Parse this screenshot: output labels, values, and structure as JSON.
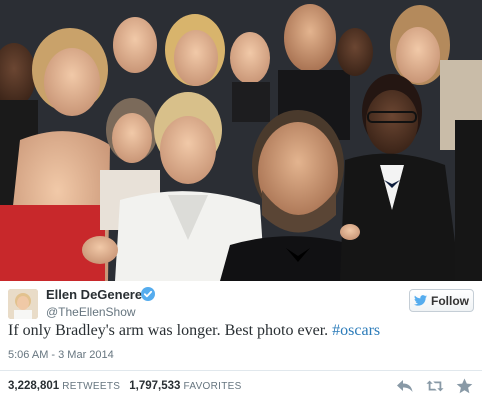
{
  "tweet": {
    "author_name": "Ellen DeGeneres",
    "handle": "@TheEllenShow",
    "follow_label": "Follow",
    "text_main": "If only Bradley's arm was longer. Best photo ever. ",
    "hashtag": "#oscars",
    "timestamp": "5:06 AM - 3 Mar 2014",
    "retweets": "3,228,801",
    "retweets_label": "RETWEETS",
    "favorites": "1,797,533",
    "favorites_label": "FAVORITES"
  },
  "icons": {
    "verified": "verified-badge-icon",
    "follow": "bird-icon",
    "reply": "reply-icon",
    "retweet": "retweet-icon",
    "favorite": "star-icon"
  },
  "colors": {
    "link": "#2b7bb9",
    "verified": "#55acee",
    "muted": "#66757f"
  }
}
